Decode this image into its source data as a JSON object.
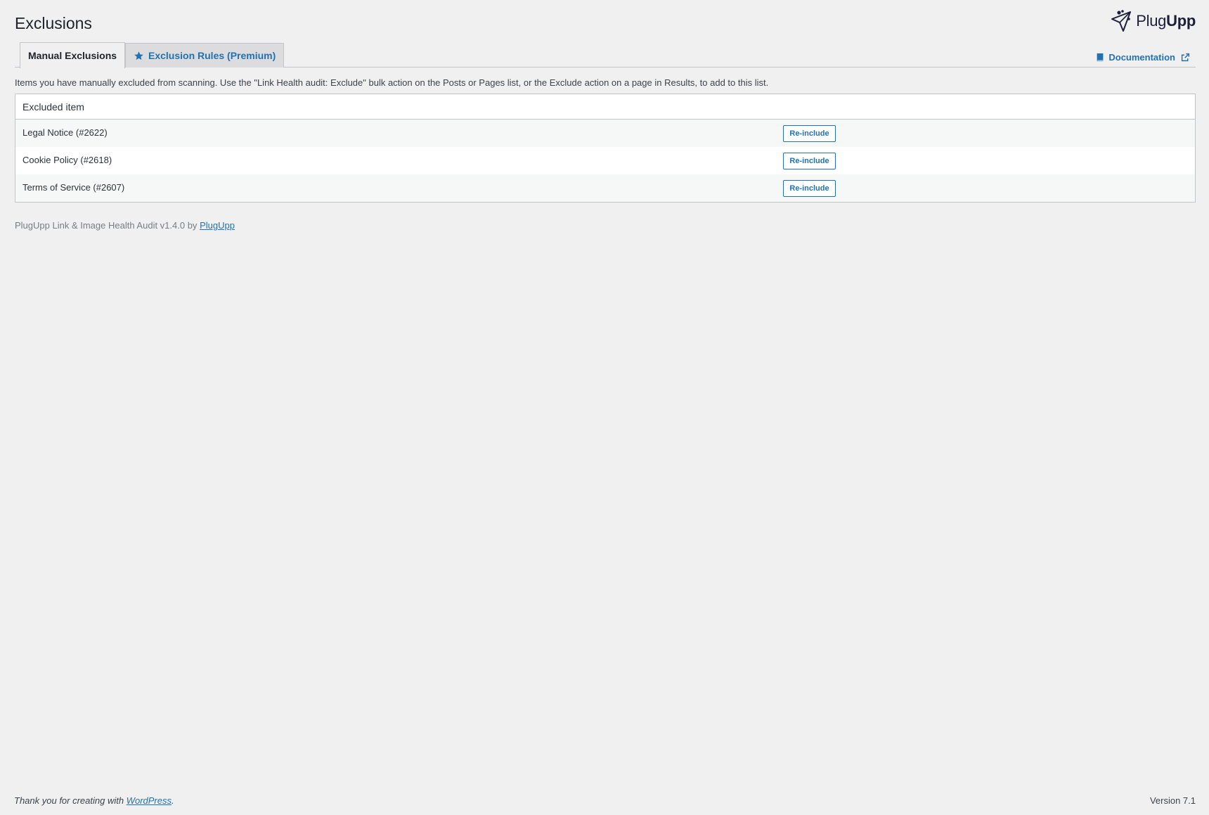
{
  "page": {
    "title": "Exclusions"
  },
  "brand": {
    "name_light": "Plug",
    "name_bold": "Upp",
    "icon": "plugupp-logo-icon"
  },
  "tabs": [
    {
      "label": "Manual Exclusions",
      "active": true
    },
    {
      "label": "Exclusion Rules (Premium)",
      "active": false,
      "icon": "star-icon"
    }
  ],
  "documentation": {
    "label": "Documentation",
    "icon": "book-icon",
    "external_icon": "external-link-icon"
  },
  "intro": "Items you have manually excluded from scanning. Use the \"Link Health audit: Exclude\" bulk action on the Posts or Pages list, or the Exclude action on a page in Results, to add to this list.",
  "table": {
    "header": "Excluded item",
    "rows": [
      {
        "label": "Legal Notice (#2622)",
        "action": "Re-include"
      },
      {
        "label": "Cookie Policy (#2618)",
        "action": "Re-include"
      },
      {
        "label": "Terms of Service (#2607)",
        "action": "Re-include"
      }
    ]
  },
  "plugin_footer": {
    "text": "PlugUpp Link & Image Health Audit v1.4.0 by",
    "link": "PlugUpp"
  },
  "wp_footer": {
    "thanks_prefix": "Thank you for creating with",
    "thanks_link": "WordPress",
    "thanks_suffix": ".",
    "version": "Version 7.1"
  },
  "colors": {
    "accent": "#2271b1",
    "background": "#f0f0f1",
    "border": "#c3c4c7"
  }
}
